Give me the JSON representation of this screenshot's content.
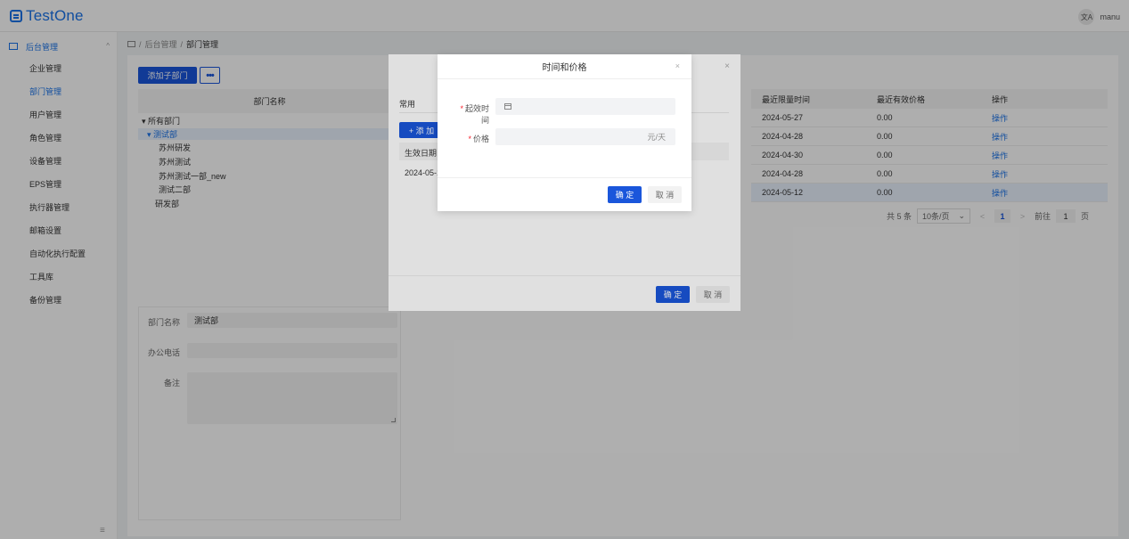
{
  "header": {
    "logo_text": "TestOne",
    "lang_icon_text": "文A",
    "username": "manu"
  },
  "sidebar": {
    "group_label": "后台管理",
    "group_caret": "^",
    "items": [
      {
        "label": "企业管理"
      },
      {
        "label": "部门管理"
      },
      {
        "label": "用户管理"
      },
      {
        "label": "角色管理"
      },
      {
        "label": "设备管理"
      },
      {
        "label": "EPS管理"
      },
      {
        "label": "执行器管理"
      },
      {
        "label": "邮箱设置"
      },
      {
        "label": "自动化执行配置"
      },
      {
        "label": "工具库"
      },
      {
        "label": "备份管理"
      }
    ],
    "active_index": 1,
    "collapse_glyph": "≡"
  },
  "breadcrumb": {
    "sep": "/",
    "parent": "后台管理",
    "current": "部门管理"
  },
  "toolbar": {
    "add_sub_label": "添加子部门",
    "more_label": "•••"
  },
  "tree": {
    "header": "部门名称",
    "nodes": [
      {
        "label": "▾ 所有部门"
      },
      {
        "label": "▾ 测试部"
      },
      {
        "label": "苏州研发"
      },
      {
        "label": "苏州测试"
      },
      {
        "label": "苏州测试一部_new"
      },
      {
        "label": "测试二部"
      },
      {
        "label": "研发部"
      }
    ]
  },
  "dept_form": {
    "name_label": "部门名称",
    "name_value": "测试部",
    "phone_label": "办公电话",
    "phone_value": "",
    "note_label": "备注"
  },
  "price_table": {
    "headers": [
      "最近限量时间",
      "最近有效价格",
      "操作"
    ],
    "rows": [
      {
        "time": "2024-05-27",
        "price": "0.00",
        "op": "操作"
      },
      {
        "time": "2024-04-28",
        "price": "0.00",
        "op": "操作"
      },
      {
        "time": "2024-04-30",
        "price": "0.00",
        "op": "操作"
      },
      {
        "time": "2024-04-28",
        "price": "0.00",
        "op": "操作"
      },
      {
        "time": "2024-05-12",
        "price": "0.00",
        "op": "操作"
      }
    ],
    "selected_row": 4
  },
  "pager": {
    "total": "共 5 条",
    "page_size": "10条/页",
    "prev": "<",
    "current": "1",
    "next": ">",
    "goto_label": "前往",
    "goto_value": "1",
    "goto_suffix": "页"
  },
  "dialog_back": {
    "close_glyph": "×",
    "tab_label": "常用",
    "add_label": "+ 添 加",
    "col_header": "生效日期",
    "cell_value": "2024-05-1",
    "ok_label": "确 定",
    "cancel_label": "取 消"
  },
  "dialog_front": {
    "title": "时间和价格",
    "close_glyph": "×",
    "start_label": "起效时间",
    "price_label": "价格",
    "required_mark": "*",
    "price_suffix": "元/天",
    "ok_label": "确 定",
    "cancel_label": "取 消"
  }
}
